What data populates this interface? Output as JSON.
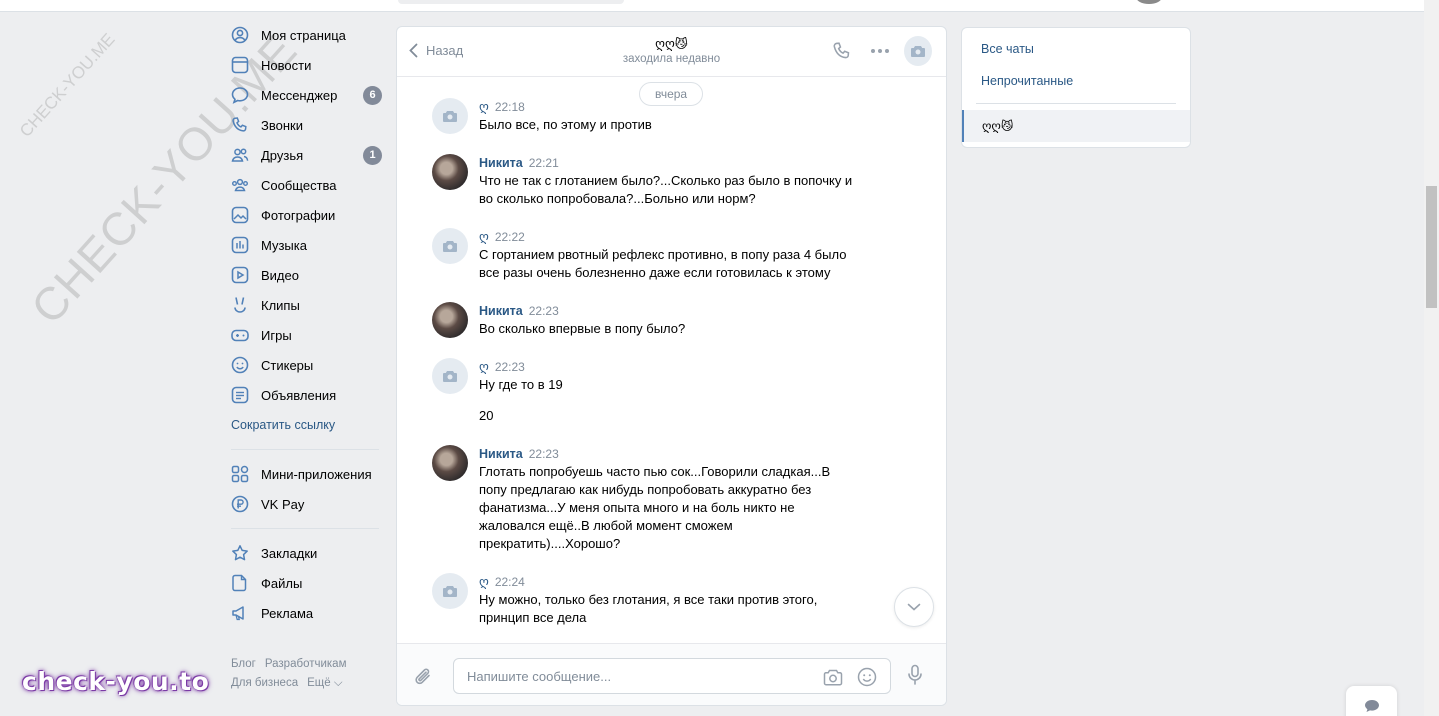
{
  "nav": {
    "items": [
      {
        "label": "Моя страница",
        "icon": "user-icon"
      },
      {
        "label": "Новости",
        "icon": "news-icon"
      },
      {
        "label": "Мессенджер",
        "icon": "messenger-icon",
        "badge": "6"
      },
      {
        "label": "Звонки",
        "icon": "phone-icon"
      },
      {
        "label": "Друзья",
        "icon": "friends-icon",
        "badge": "1"
      },
      {
        "label": "Сообщества",
        "icon": "communities-icon"
      },
      {
        "label": "Фотографии",
        "icon": "photos-icon"
      },
      {
        "label": "Музыка",
        "icon": "music-icon"
      },
      {
        "label": "Видео",
        "icon": "video-icon"
      },
      {
        "label": "Клипы",
        "icon": "clips-icon"
      },
      {
        "label": "Игры",
        "icon": "games-icon"
      },
      {
        "label": "Стикеры",
        "icon": "stickers-icon"
      },
      {
        "label": "Объявления",
        "icon": "classifieds-icon"
      }
    ],
    "shorten_link": "Сократить ссылку",
    "items2": [
      {
        "label": "Мини-приложения",
        "icon": "mini-apps-icon"
      },
      {
        "label": "VK Pay",
        "icon": "vkpay-icon"
      }
    ],
    "items3": [
      {
        "label": "Закладки",
        "icon": "bookmark-icon"
      },
      {
        "label": "Файлы",
        "icon": "files-icon"
      },
      {
        "label": "Реклама",
        "icon": "ads-icon"
      }
    ],
    "footer": [
      "Блог",
      "Разработчикам",
      "Для бизнеса",
      "Ещё ⌵"
    ]
  },
  "chat": {
    "back_label": "Назад",
    "peer_name": "ღღ😼",
    "peer_status": "заходила недавно",
    "date_separator": "вчера",
    "messages": [
      {
        "author": "ღ",
        "time": "22:18",
        "text": "Было все, по этому и против"
      },
      {
        "author": "Никита",
        "time": "22:21",
        "text": "Что не так с глотанием было?...Сколько раз было в попочку и во сколько попробовала?...Больно или норм?"
      },
      {
        "author": "ღ",
        "time": "22:22",
        "text": "С гортанием рвотный рефлекс противно, в попу раза 4 было все разы очень болезненно даже если готовилась к этому"
      },
      {
        "author": "Никита",
        "time": "22:23",
        "text": "Во сколько впервые в попу было?"
      },
      {
        "author": "ღ",
        "time": "22:23",
        "text": "Ну где то в 19",
        "text2": "20"
      },
      {
        "author": "Никита",
        "time": "22:23",
        "text": "Глотать попробуешь часто пью сок...Говорили сладкая...В попу предлагаю как нибудь попробовать аккуратно без фанатизма...У меня опыта много и на боль никто не жаловался ещё..В любой момент сможем прекратить)....Хорошо?"
      },
      {
        "author": "ღ",
        "time": "22:24",
        "text": "Ну можно, только без глотания, я все таки против этого, принцип все дела"
      }
    ],
    "composer_placeholder": "Напишите сообщение..."
  },
  "right_panel": {
    "all_chats": "Все чаты",
    "unread": "Непрочитанные",
    "selected_chat": "ღღ😼"
  },
  "watermarks": {
    "small": "CHECK-YOU.ME",
    "large": "CHECK-YOU.ME",
    "brand": "check-you.to"
  },
  "colors": {
    "link": "#2a5885",
    "badge": "#828a99",
    "muted": "#818c99",
    "background": "#edeef0"
  }
}
